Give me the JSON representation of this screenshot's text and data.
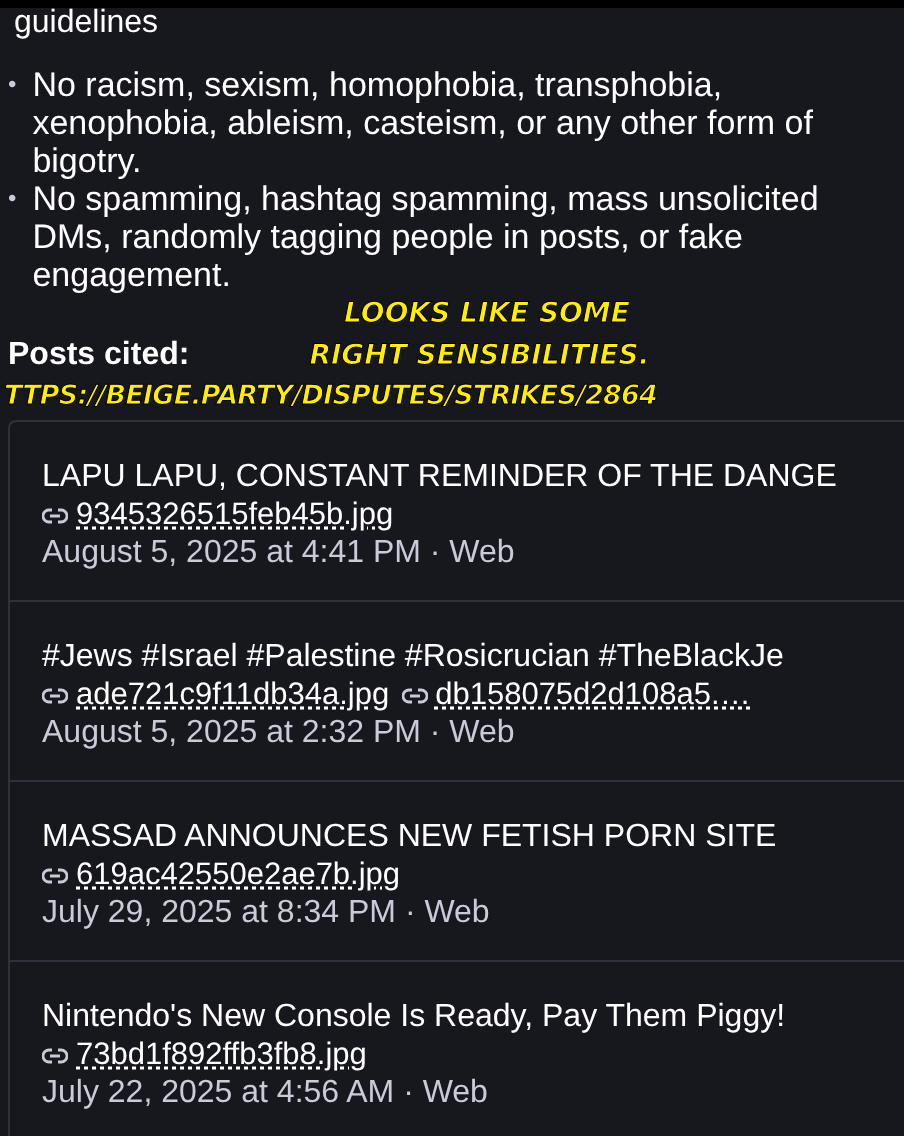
{
  "intro_tail": "guidelines",
  "rules": [
    {
      "bullet": "•",
      "text": "No racism, sexism, homophobia, transphobia, xenophobia, ableism, casteism, or any other form of bigotry."
    },
    {
      "bullet": "•",
      "text": "No spamming, hashtag spamming, mass unsolicited DMs, randomly tagging people in posts, or fake engagement."
    }
  ],
  "section_heading": "Posts cited:",
  "annotation": {
    "lines": [
      "LOOKS LIKE SOME",
      "RIGHT SENSIBILITIES."
    ],
    "url": "TTPS://BEIGE.PARTY/DISPUTES/STRIKES/2864"
  },
  "posts": [
    {
      "title": "LAPU LAPU, CONSTANT REMINDER OF THE DANGE",
      "attachments": [
        "9345326515feb45b.jpg"
      ],
      "meta": "August 5, 2025 at 4:41 PM · Web"
    },
    {
      "title": "#Jews #Israel #Palestine #Rosicrucian #TheBlackJe",
      "attachments": [
        "ade721c9f11db34a.jpg",
        "db158075d2d108a5.…"
      ],
      "meta": "August 5, 2025 at 2:32 PM · Web"
    },
    {
      "title": "MASSAD ANNOUNCES NEW FETISH PORN SITE",
      "attachments": [
        "619ac42550e2ae7b.jpg"
      ],
      "meta": "July 29, 2025 at 8:34 PM · Web"
    },
    {
      "title": "Nintendo's New Console Is Ready, Pay Them Piggy!",
      "attachments": [
        "73bd1f892ffb3fb8.jpg"
      ],
      "meta": "July 22, 2025 at 4:56 AM · Web"
    }
  ]
}
